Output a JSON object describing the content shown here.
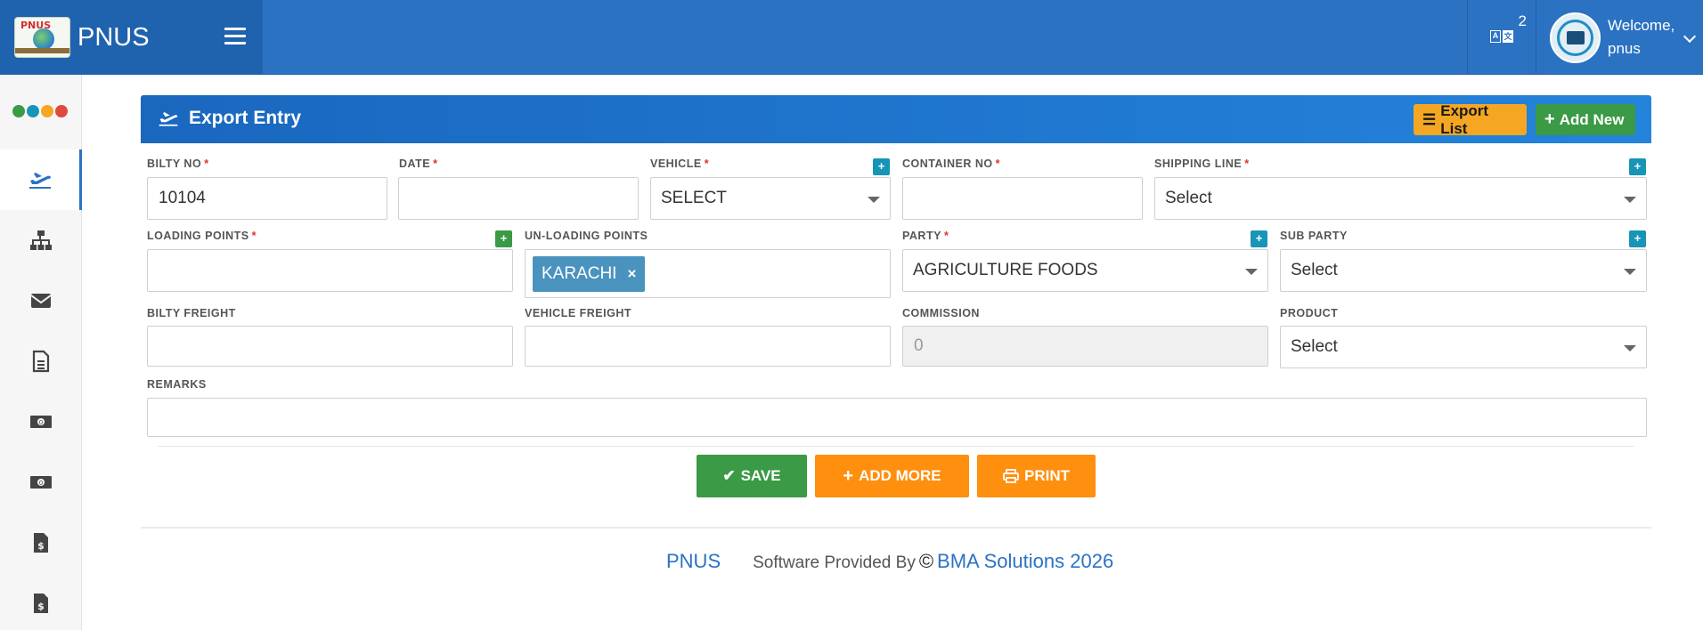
{
  "header": {
    "brand_name": "PNUS",
    "logo_text": "PNUS",
    "lang_count": "2",
    "welcome": "Welcome,",
    "username": "pnus"
  },
  "sidebar": {
    "dot_colors": [
      "#3a9a45",
      "#1795b7",
      "#f5a623",
      "#e0493b"
    ],
    "items": [
      {
        "icon": "plane-icon",
        "active": true
      },
      {
        "icon": "sitemap-icon",
        "active": false
      },
      {
        "icon": "envelope-icon",
        "active": false
      },
      {
        "icon": "document-icon",
        "active": false
      },
      {
        "icon": "money-icon",
        "active": false
      },
      {
        "icon": "money-icon",
        "active": false
      },
      {
        "icon": "invoice-icon",
        "active": false
      },
      {
        "icon": "invoice-icon",
        "active": false
      }
    ]
  },
  "card": {
    "title": "Export Entry",
    "export_list_label": "Export List",
    "add_new_label": "Add New"
  },
  "form": {
    "bilty_no": {
      "label": "BILTY NO",
      "value": "10104"
    },
    "date": {
      "label": "DATE",
      "value": ""
    },
    "vehicle": {
      "label": "VEHICLE",
      "value": "SELECT"
    },
    "container_no": {
      "label": "CONTAINER NO",
      "value": ""
    },
    "shipping_line": {
      "label": "SHIPPING LINE",
      "value": "Select"
    },
    "loading_points": {
      "label": "LOADING POINTS",
      "value": ""
    },
    "unloading_points": {
      "label": "UN-LOADING POINTS",
      "tag": "KARACHI"
    },
    "party": {
      "label": "PARTY",
      "value": "AGRICULTURE FOODS"
    },
    "sub_party": {
      "label": "SUB PARTY",
      "value": "Select"
    },
    "bilty_freight": {
      "label": "BILTY FREIGHT",
      "value": ""
    },
    "vehicle_freight": {
      "label": "VEHICLE FREIGHT",
      "value": ""
    },
    "commission": {
      "label": "COMMISSION",
      "value": "0"
    },
    "product": {
      "label": "PRODUCT",
      "value": "Select"
    },
    "remarks": {
      "label": "REMARKS",
      "value": ""
    },
    "required_mark": "*",
    "plus": "+",
    "tag_remove": "×"
  },
  "actions": {
    "save": "SAVE",
    "add_more": "ADD MORE",
    "print": "PRINT"
  },
  "footer": {
    "brand": "PNUS",
    "provided_by": "Software Provided By",
    "copyright": "©",
    "company": "BMA Solutions 2026"
  }
}
